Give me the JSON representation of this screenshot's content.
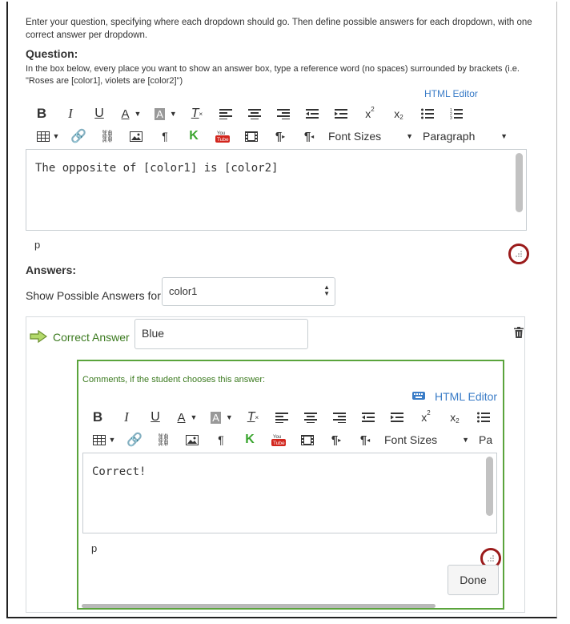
{
  "intro": "Enter your question, specifying where each dropdown should go. Then define possible answers for each dropdown, with one correct answer per dropdown.",
  "question": {
    "heading": "Question:",
    "help": "In the box below, every place you want to show an answer box, type a reference word (no spaces) surrounded by brackets (i.e. \"Roses are [color1], violets are [color2]\")",
    "html_editor": "HTML Editor",
    "content": "The opposite of [color1] is [color2]",
    "path": "p",
    "font_sizes": "Font Sizes",
    "paragraph": "Paragraph"
  },
  "answers": {
    "heading": "Answers:",
    "show_label": "Show Possible Answers for",
    "selected": "color1",
    "correct_label": "Correct Answer",
    "correct_value": "Blue",
    "comments_label": "Comments, if the student chooses this answer:",
    "html_editor": "HTML Editor",
    "comment_content": "Correct!",
    "path": "p",
    "font_sizes": "Font Sizes",
    "paragraph_partial": "Pa",
    "done": "Done"
  },
  "colors": {
    "accent": "#3a7cc7",
    "correct_green": "#3b7a1f",
    "callout_red": "#9b1b1b"
  }
}
